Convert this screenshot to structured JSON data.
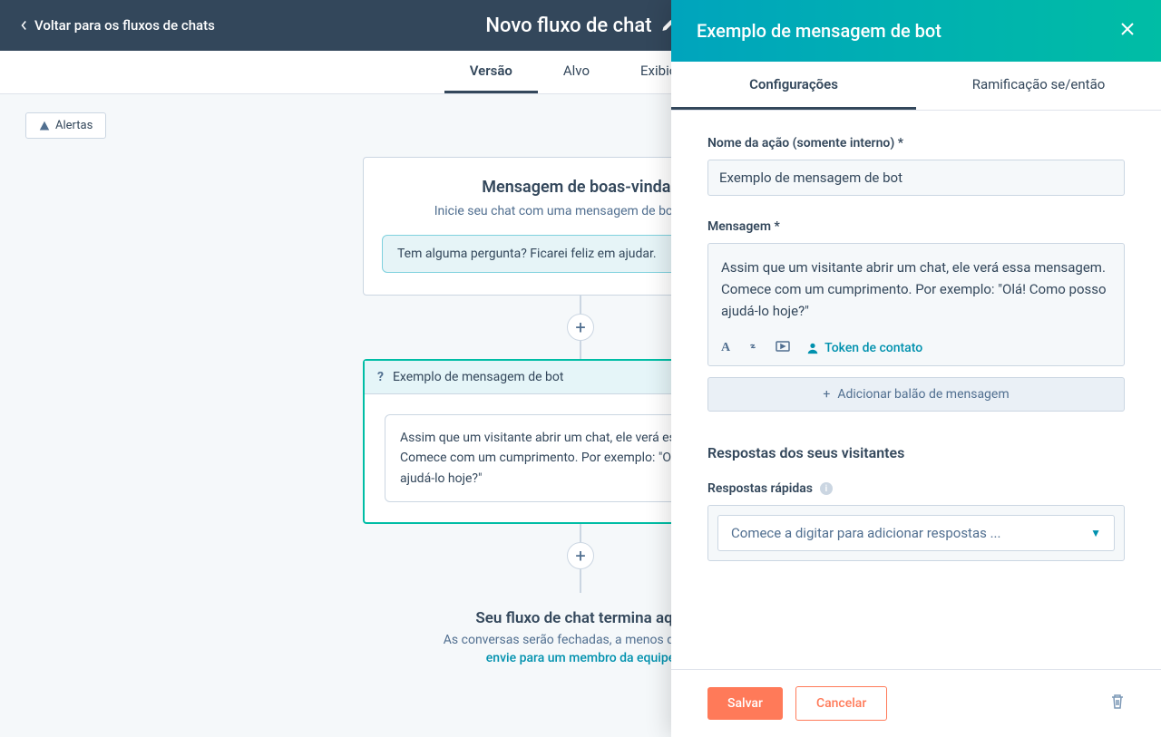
{
  "header": {
    "back_label": "Voltar para os fluxos de chats",
    "title": "Novo fluxo de chat"
  },
  "main_tabs": {
    "version": "Versão",
    "target": "Alvo",
    "display": "Exibição"
  },
  "alerts_button": "Alertas",
  "flow": {
    "welcome": {
      "title": "Mensagem de boas-vindas",
      "subtitle": "Inicie seu chat com uma mensagem de boas-vindas",
      "bubble": "Tem alguma pergunta? Ficarei feliz em ajudar."
    },
    "step": {
      "name": "Exemplo de mensagem de bot",
      "message": "Assim que um visitante abrir um chat, ele verá essa mensagem. Comece com um cumprimento. Por exemplo: \"Olá! Como posso ajudá-lo hoje?\""
    },
    "end": {
      "title": "Seu fluxo de chat termina aqui",
      "subtitle": "As conversas serão fechadas, a menos que você",
      "link": "envie para um membro da equipe"
    }
  },
  "panel": {
    "title": "Exemplo de mensagem de bot",
    "tabs": {
      "config": "Configurações",
      "branch": "Ramificação se/então"
    },
    "action_name_label": "Nome da ação (somente interno) *",
    "action_name_value": "Exemplo de mensagem de bot",
    "message_label": "Mensagem *",
    "message_value": "Assim que um visitante abrir um chat, ele verá essa mensagem. Comece com um cumprimento. Por exemplo: \"Olá! Como posso ajudá-lo hoje?\"",
    "token_link": "Token de contato",
    "add_bubble": "Adicionar balão de mensagem",
    "responses_title": "Respostas dos seus visitantes",
    "quick_replies_label": "Respostas rápidas",
    "quick_replies_placeholder": "Comece a digitar para adicionar respostas ...",
    "save": "Salvar",
    "cancel": "Cancelar"
  }
}
